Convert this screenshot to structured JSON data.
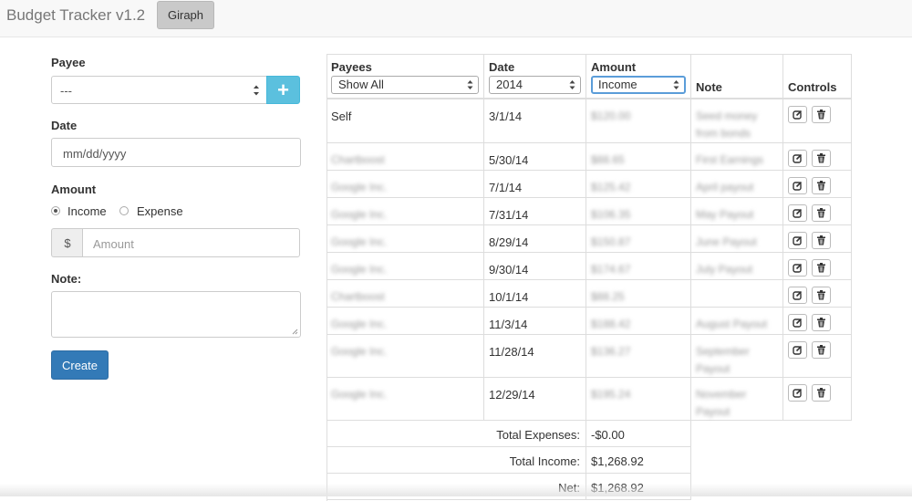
{
  "app": {
    "title": "Budget Tracker v1.2",
    "nav_button": "Giraph"
  },
  "form": {
    "payee_label": "Payee",
    "payee_value": "---",
    "add_button": "+",
    "date_label": "Date",
    "date_placeholder": "mm/dd/yyyy",
    "amount_label": "Amount",
    "radio_income": "Income",
    "radio_expense": "Expense",
    "radio_selected": "Income",
    "currency_symbol": "$",
    "amount_placeholder": "Amount",
    "note_label": "Note:",
    "create_button": "Create"
  },
  "table": {
    "headers": {
      "payees": "Payees",
      "payees_filter": "Show All",
      "date": "Date",
      "date_filter": "2014",
      "amount": "Amount",
      "amount_filter": "Income",
      "note": "Note",
      "controls": "Controls"
    },
    "rows": [
      {
        "payee": "Self",
        "date": "3/1/14",
        "amount": "$120.00",
        "note": "Seed money from bonds"
      },
      {
        "payee": "Chartboost",
        "date": "5/30/14",
        "amount": "$88.65",
        "note": "First Earnings"
      },
      {
        "payee": "Google Inc.",
        "date": "7/1/14",
        "amount": "$125.42",
        "note": "April payout"
      },
      {
        "payee": "Google Inc.",
        "date": "7/31/14",
        "amount": "$106.35",
        "note": "May Payout"
      },
      {
        "payee": "Google Inc.",
        "date": "8/29/14",
        "amount": "$150.87",
        "note": "June Payout"
      },
      {
        "payee": "Google Inc.",
        "date": "9/30/14",
        "amount": "$174.67",
        "note": "July Payout"
      },
      {
        "payee": "Chartboost",
        "date": "10/1/14",
        "amount": "$88.25",
        "note": ""
      },
      {
        "payee": "Google Inc.",
        "date": "11/3/14",
        "amount": "$188.42",
        "note": "August Payout"
      },
      {
        "payee": "Google Inc.",
        "date": "11/28/14",
        "amount": "$136.27",
        "note": "September Payout"
      },
      {
        "payee": "Google Inc.",
        "date": "12/29/14",
        "amount": "$195.24",
        "note": "November Payout"
      }
    ],
    "totals": [
      {
        "label": "Total Expenses:",
        "value": "-$0.00"
      },
      {
        "label": "Total Income:",
        "value": "$1,268.92"
      },
      {
        "label": "Net:",
        "value": "$1,268.92"
      }
    ]
  },
  "icons": {
    "add": "plus-icon",
    "edit": "edit-icon",
    "delete": "trash-icon",
    "select": "select-arrows-icon"
  },
  "colors": {
    "primary": "#337ab7",
    "info": "#5bc0de",
    "nav_bg": "#f8f8f8",
    "focus": "#5b9dd9"
  }
}
